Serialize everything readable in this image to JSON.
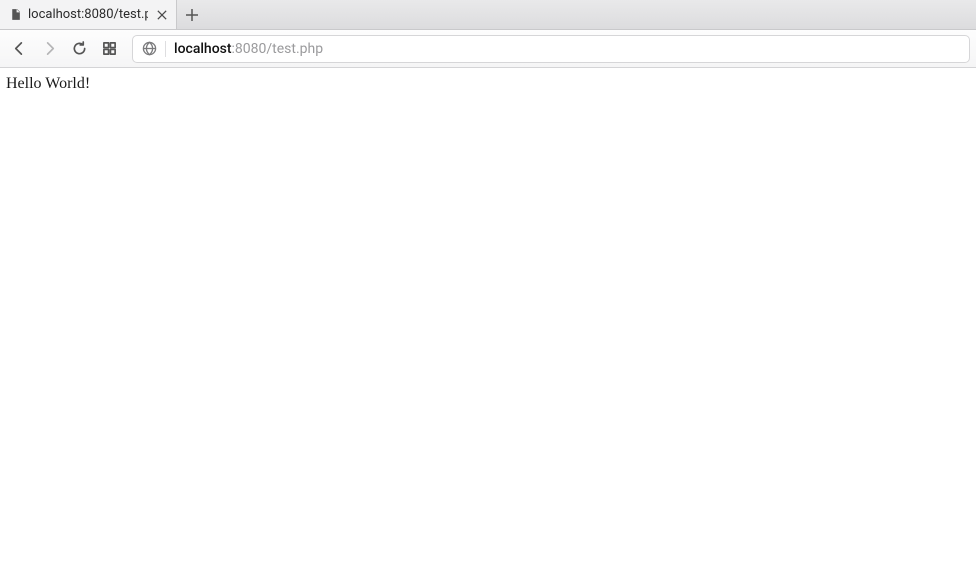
{
  "tab": {
    "title": "localhost:8080/test.p"
  },
  "address": {
    "host": "localhost",
    "rest": ":8080/test.php"
  },
  "page": {
    "body_text": "Hello World!"
  }
}
